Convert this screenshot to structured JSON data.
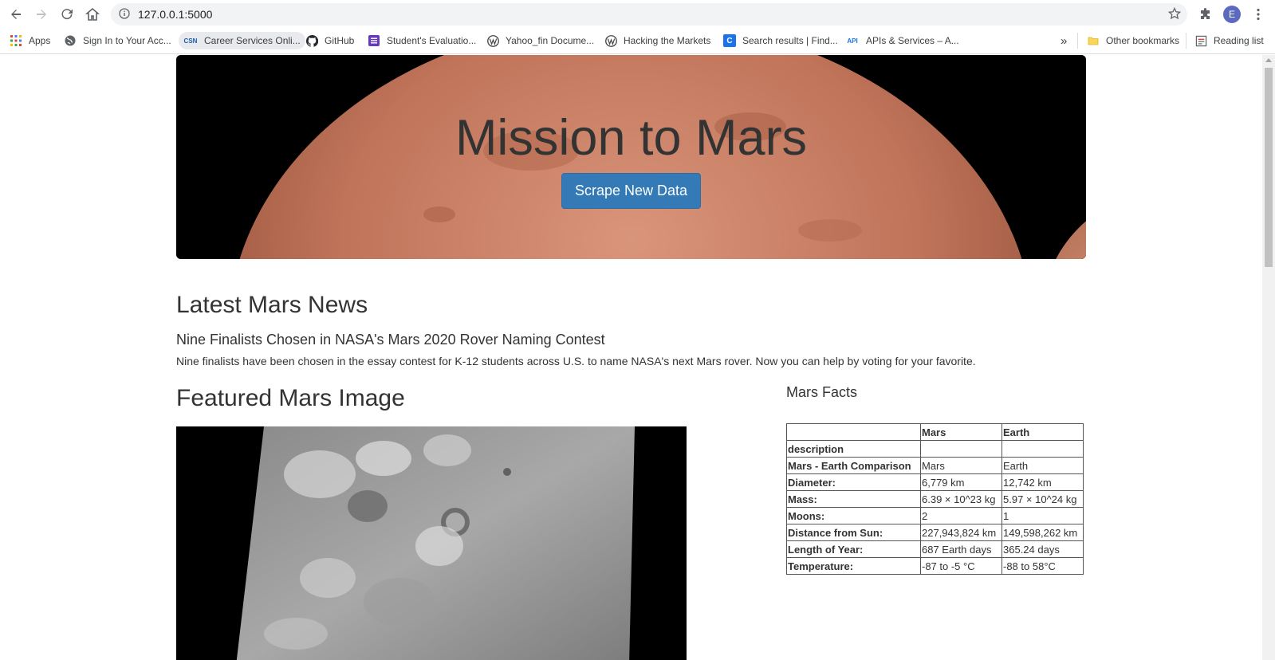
{
  "browser": {
    "url": "127.0.0.1:5000",
    "avatar_letter": "E",
    "bookmarks": [
      {
        "label": "Apps",
        "icon": "apps-grid-icon"
      },
      {
        "label": "Sign In to Your Acc...",
        "icon": "globe-icon"
      },
      {
        "label": "Career Services Onli...",
        "icon": "csn-icon",
        "icon_text": "CSN"
      },
      {
        "label": "GitHub",
        "icon": "github-icon"
      },
      {
        "label": "Student's Evaluatio...",
        "icon": "forms-icon"
      },
      {
        "label": "Yahoo_fin Docume...",
        "icon": "wordpress-icon"
      },
      {
        "label": "Hacking the Markets",
        "icon": "wordpress-icon"
      },
      {
        "label": "Search results | Find...",
        "icon": "c-icon",
        "icon_text": "C"
      },
      {
        "label": "APIs & Services – A...",
        "icon": "api-icon",
        "icon_text": "API"
      }
    ],
    "overflow": "»",
    "other_bookmarks": "Other bookmarks",
    "reading_list": "Reading list"
  },
  "page": {
    "jumbotron": {
      "title": "Mission to Mars",
      "button": "Scrape New Data"
    },
    "news": {
      "heading": "Latest Mars News",
      "title": "Nine Finalists Chosen in NASA's Mars 2020 Rover Naming Contest",
      "paragraph": "Nine finalists have been chosen in the essay contest for K-12 students across U.S. to name NASA's next Mars rover. Now you can help by voting for your favorite."
    },
    "featured": {
      "heading": "Featured Mars Image"
    },
    "facts": {
      "heading": "Mars Facts",
      "columns": [
        "",
        "Mars",
        "Earth"
      ],
      "rows": [
        [
          "description",
          "",
          ""
        ],
        [
          "Mars - Earth Comparison",
          "Mars",
          "Earth"
        ],
        [
          "Diameter:",
          "6,779 km",
          "12,742 km"
        ],
        [
          "Mass:",
          "6.39 × 10^23 kg",
          "5.97 × 10^24 kg"
        ],
        [
          "Moons:",
          "2",
          "1"
        ],
        [
          "Distance from Sun:",
          "227,943,824 km",
          "149,598,262 km"
        ],
        [
          "Length of Year:",
          "687 Earth days",
          "365.24 days"
        ],
        [
          "Temperature:",
          "-87 to -5 °C",
          "-88 to 58°C"
        ]
      ]
    }
  },
  "colors": {
    "button_blue": "#337ab7",
    "mars": "#c0745a"
  }
}
